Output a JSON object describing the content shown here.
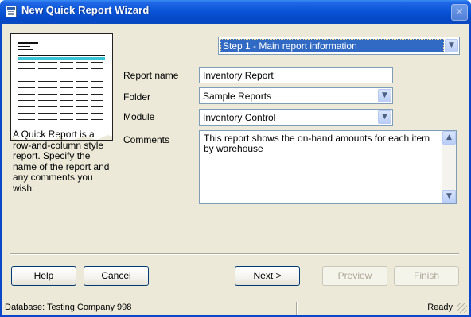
{
  "window": {
    "title": "New Quick Report Wizard",
    "close_glyph": "✕"
  },
  "step": {
    "selected": "Step 1 - Main report information",
    "arrow_glyph": "▼"
  },
  "description": "A Quick Report is a row-and-column style report. Specify the name of the report and any comments you wish.",
  "form": {
    "report_name": {
      "label": "Report name",
      "value": "Inventory Report"
    },
    "folder": {
      "label": "Folder",
      "value": "Sample Reports"
    },
    "module": {
      "label": "Module",
      "value": "Inventory Control"
    },
    "comments": {
      "label": "Comments",
      "value": "This report shows the on-hand amounts for each item by warehouse"
    }
  },
  "buttons": {
    "help": {
      "label_ul": "H",
      "label_rest": "elp"
    },
    "cancel": {
      "label": "Cancel"
    },
    "next": {
      "label": "Next >"
    },
    "preview": {
      "label_pre": "Pre",
      "label_ul": "v",
      "label_rest": "iew"
    },
    "finish": {
      "label": "Finish"
    }
  },
  "status": {
    "database": "Database: Testing Company 998",
    "state": "Ready"
  },
  "icons": {
    "app": "report-icon",
    "close": "close-icon",
    "scroll_up": "▲",
    "scroll_down": "▼"
  },
  "colors": {
    "selection": "#316ac5",
    "title_bar": "#0a55d8",
    "dialog_bg": "#ece9d8"
  }
}
